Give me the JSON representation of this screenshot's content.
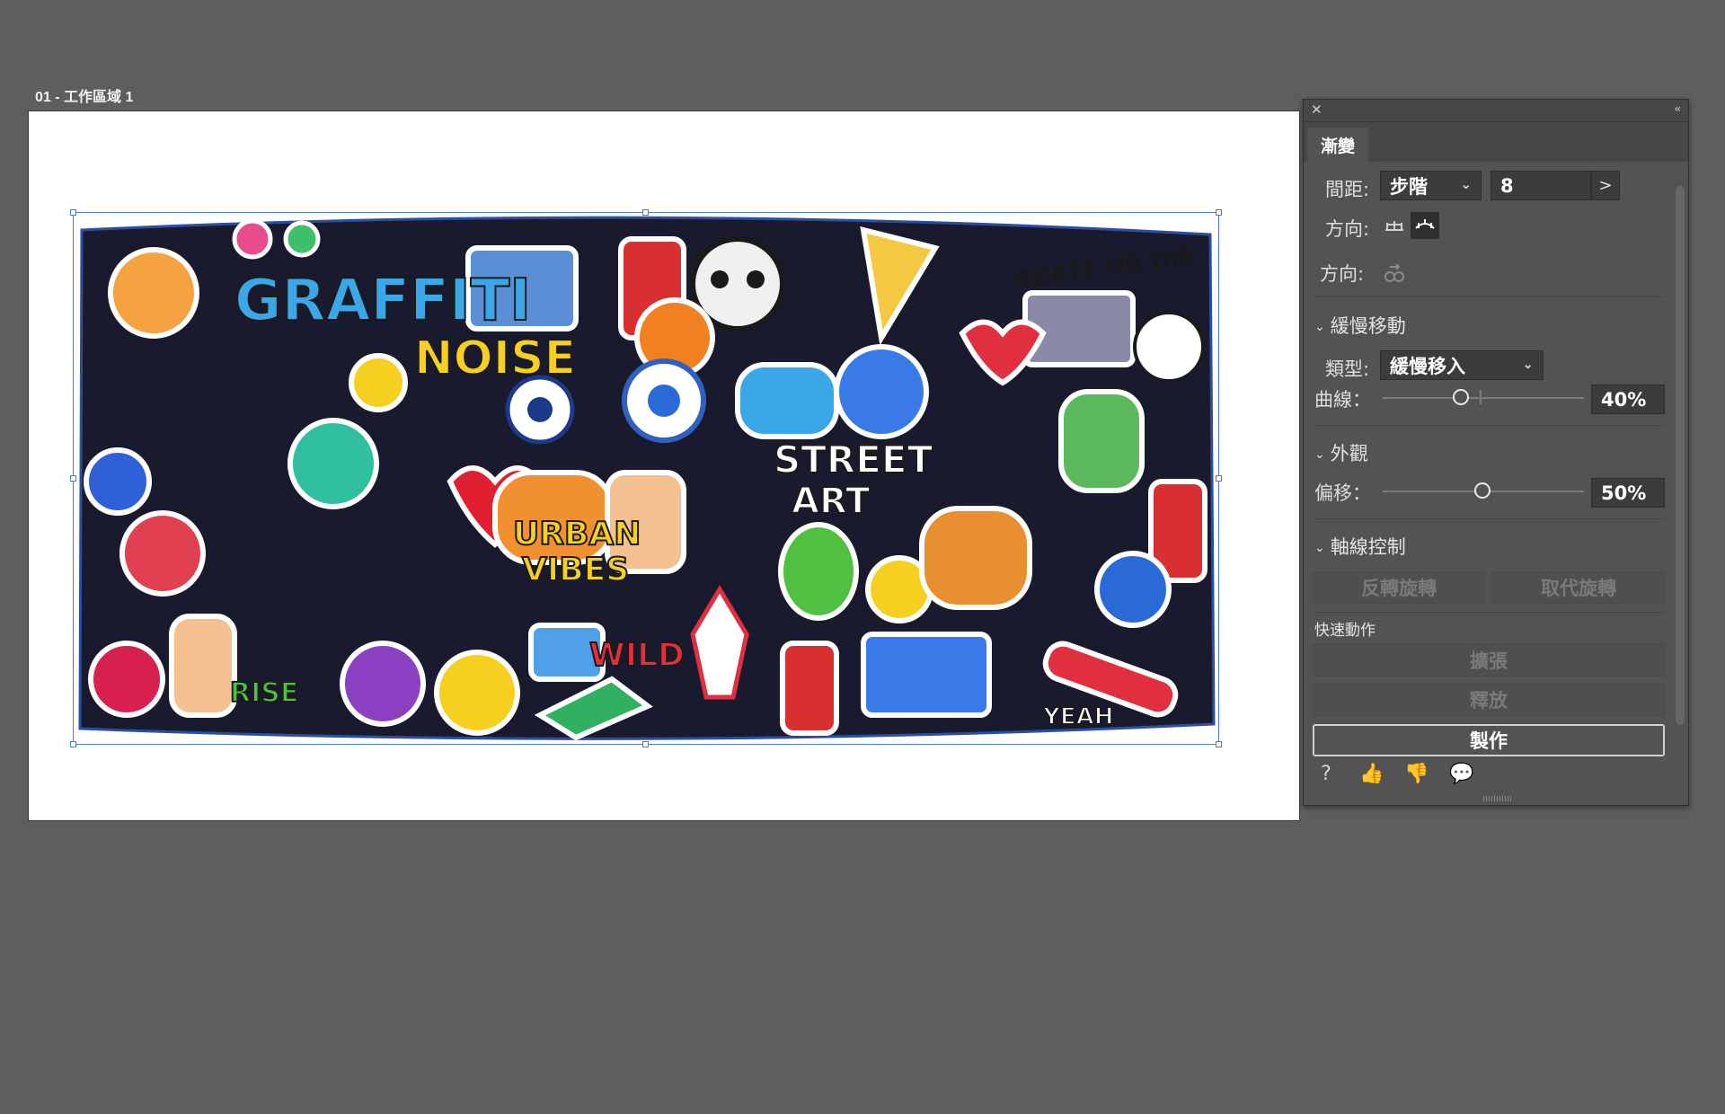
{
  "artboard": {
    "label": "01 - 工作區域 1"
  },
  "artwork_text": [
    "GRAFFITI",
    "NOISE",
    "SKATE OR DIE",
    "STREET",
    "ART",
    "URBAN",
    "VIBES",
    "RISE",
    "WILD",
    "YEAH"
  ],
  "panel": {
    "tab": "漸變",
    "spacing": {
      "label": "間距:",
      "mode": "步階",
      "value": "8",
      "next": ">"
    },
    "orientation_label": "方向:",
    "direction_label": "方向:",
    "easing": {
      "header": "緩慢移動",
      "type_label": "類型:",
      "type_value": "緩慢移入",
      "curve_label": "曲線：",
      "curve_value": "40%"
    },
    "appearance": {
      "header": "外觀",
      "offset_label": "偏移：",
      "offset_value": "50%"
    },
    "spine": {
      "header": "軸線控制",
      "reverse_button": "反轉旋轉",
      "replace_button": "取代旋轉"
    },
    "quick_actions": {
      "label": "快速動作",
      "expand": "擴張",
      "release": "釋放",
      "make": "製作"
    }
  },
  "colors": {
    "panel_bg": "#535353",
    "canvas_bg": "#5e5e5e",
    "selection": "#4a7bd8"
  }
}
